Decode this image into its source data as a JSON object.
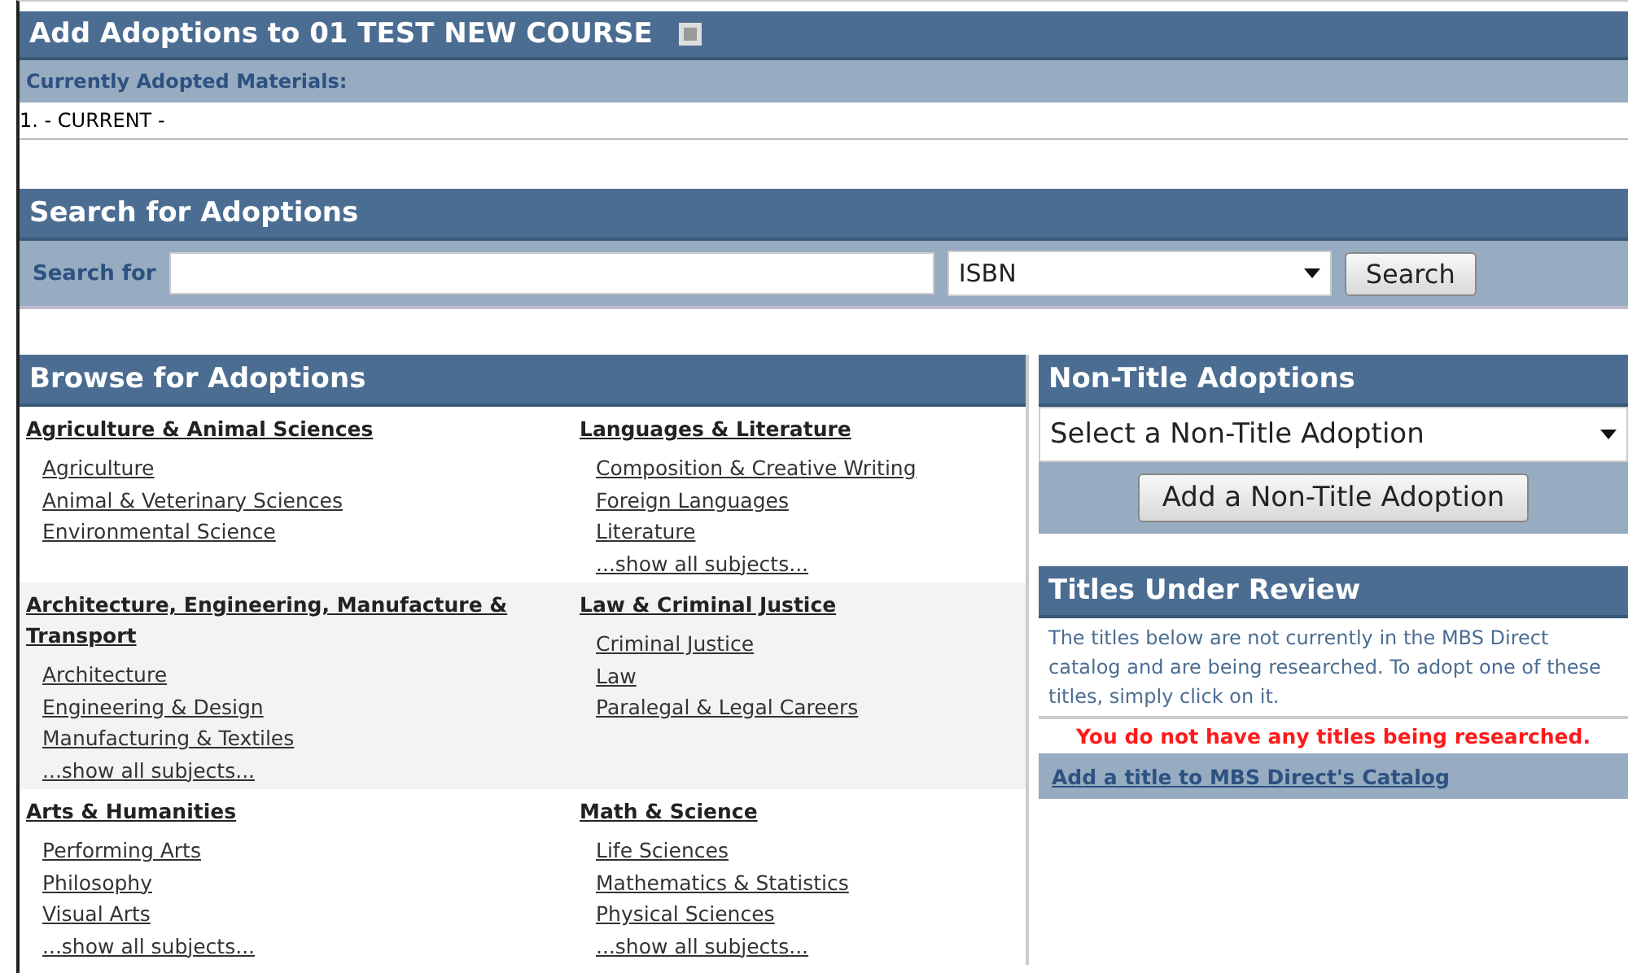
{
  "title": "Add Adoptions to 01 TEST NEW COURSE",
  "adopted": {
    "label": "Currently Adopted Materials:",
    "items": [
      "1. - CURRENT -"
    ]
  },
  "search": {
    "title": "Search for Adoptions",
    "label": "Search for",
    "type": "ISBN",
    "button": "Search"
  },
  "browse": {
    "title": "Browse for Adoptions",
    "groups": [
      {
        "category": "Agriculture & Animal Sciences",
        "subjects": [
          "Agriculture",
          "Animal & Veterinary Sciences",
          "Environmental Science"
        ]
      },
      {
        "category": "Languages & Literature",
        "subjects": [
          "Composition & Creative Writing",
          "Foreign Languages",
          "Literature"
        ],
        "more": "...show all subjects..."
      },
      {
        "category": "Architecture, Engineering, Manufacture & Transport",
        "subjects": [
          "Architecture",
          "Engineering & Design",
          "Manufacturing & Textiles"
        ],
        "more": "...show all subjects..."
      },
      {
        "category": "Law & Criminal Justice",
        "subjects": [
          "Criminal Justice",
          "Law",
          "Paralegal & Legal Careers"
        ]
      },
      {
        "category": "Arts & Humanities",
        "subjects": [
          "Performing Arts",
          "Philosophy",
          "Visual Arts"
        ],
        "more": "...show all subjects..."
      },
      {
        "category": "Math & Science",
        "subjects": [
          "Life Sciences",
          "Mathematics & Statistics",
          "Physical Sciences"
        ],
        "more": "...show all subjects..."
      }
    ]
  },
  "non_title": {
    "title": "Non-Title Adoptions",
    "select": "Select a Non-Title Adoption",
    "button": "Add a Non-Title Adoption"
  },
  "review": {
    "title": "Titles Under Review",
    "description": "The titles below are not currently in the MBS Direct catalog and are being researched. To adopt one of these titles, simply click on it.",
    "empty": "You do not have any titles being researched.",
    "link": "Add a title to MBS Direct's Catalog"
  }
}
